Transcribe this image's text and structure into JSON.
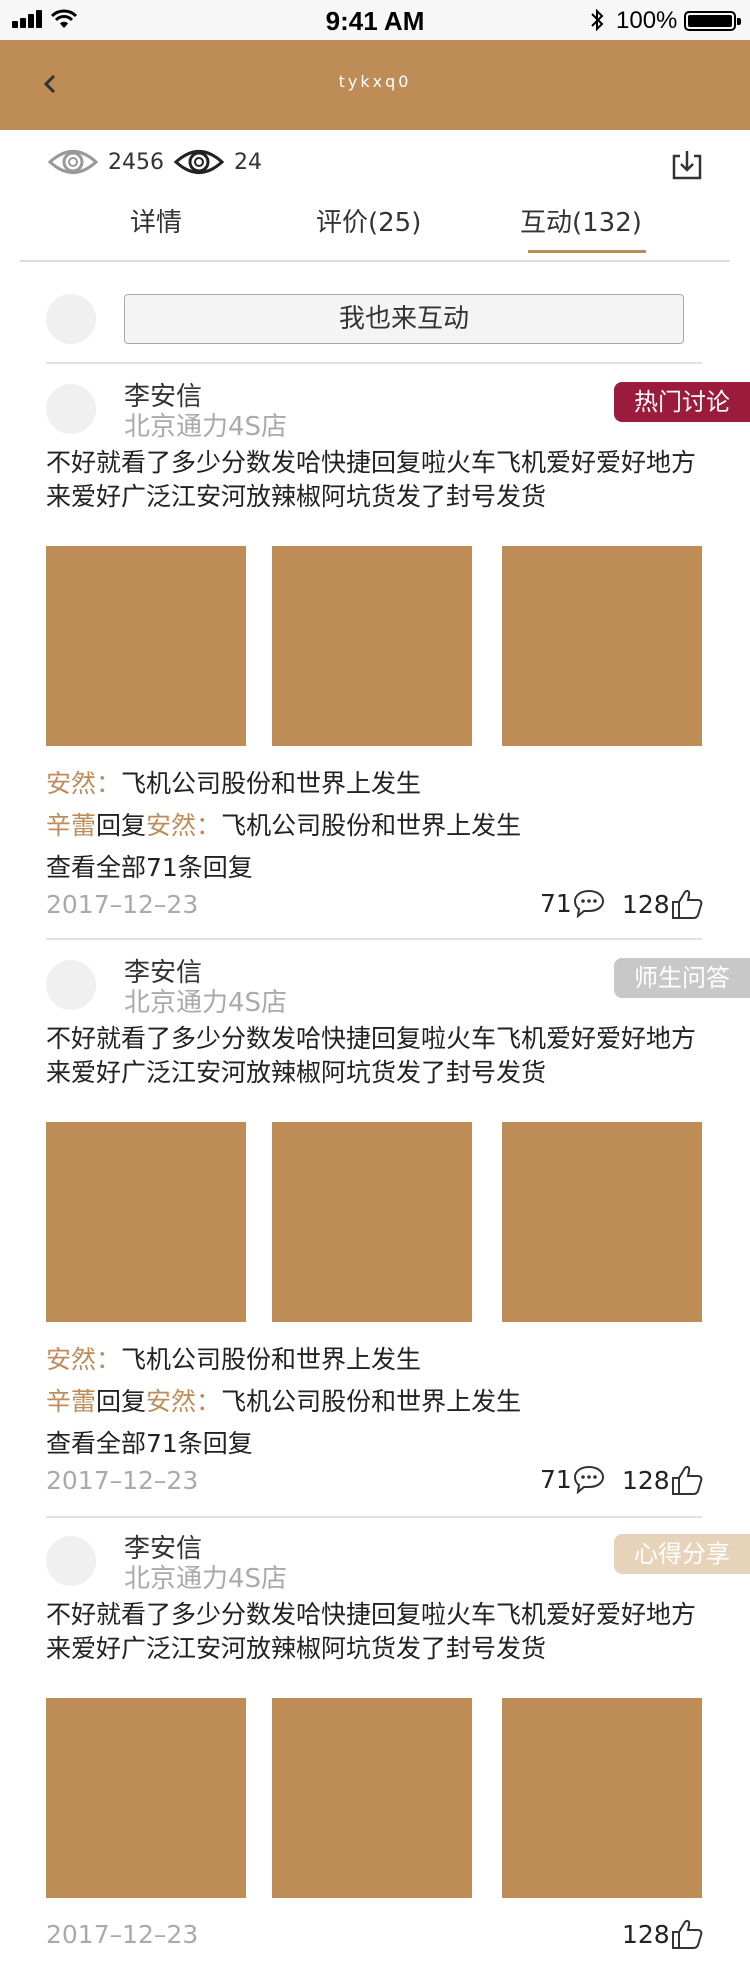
{
  "status_bar": {
    "time": "9:41 AM",
    "battery": "100%"
  },
  "nav": {
    "title": "tykxq0"
  },
  "stats": {
    "views": "2456",
    "watching": "24"
  },
  "tabs": [
    {
      "label": "详情"
    },
    {
      "label": "评价(25)"
    },
    {
      "label": "互动(132)"
    }
  ],
  "interact_button": "我也来互动",
  "posts": [
    {
      "author": "李安信",
      "store": "北京通力4S店",
      "badge": "热门讨论",
      "badge_color": "#9b1b3c",
      "text": "不好就看了多少分数发哈快捷回复啦火车飞机爱好爱好地方来爱好广泛江安河放辣椒阿坑货发了封号发货",
      "replies": [
        {
          "name": "安然",
          "sep": "：",
          "text": "飞机公司股份和世界上发生"
        },
        {
          "name": "辛蕾",
          "mid": "回复",
          "target": "安然",
          "sep": "：",
          "text": "飞机公司股份和世界上发生"
        }
      ],
      "view_all": "查看全部71条回复",
      "date": "2017–12–23",
      "comments": "71",
      "likes": "128"
    },
    {
      "author": "李安信",
      "store": "北京通力4S店",
      "badge": "师生问答",
      "badge_color": "#c8c8c8",
      "text": "不好就看了多少分数发哈快捷回复啦火车飞机爱好爱好地方来爱好广泛江安河放辣椒阿坑货发了封号发货",
      "replies": [
        {
          "name": "安然",
          "sep": "：",
          "text": "飞机公司股份和世界上发生"
        },
        {
          "name": "辛蕾",
          "mid": "回复",
          "target": "安然",
          "sep": "：",
          "text": "飞机公司股份和世界上发生"
        }
      ],
      "view_all": "查看全部71条回复",
      "date": "2017–12–23",
      "comments": "71",
      "likes": "128"
    },
    {
      "author": "李安信",
      "store": "北京通力4S店",
      "badge": "心得分享",
      "badge_color": "#e6d3b9",
      "text": "不好就看了多少分数发哈快捷回复啦火车飞机爱好爱好地方来爱好广泛江安河放辣椒阿坑货发了封号发货",
      "date": "2017–12–23",
      "likes": "128"
    }
  ]
}
